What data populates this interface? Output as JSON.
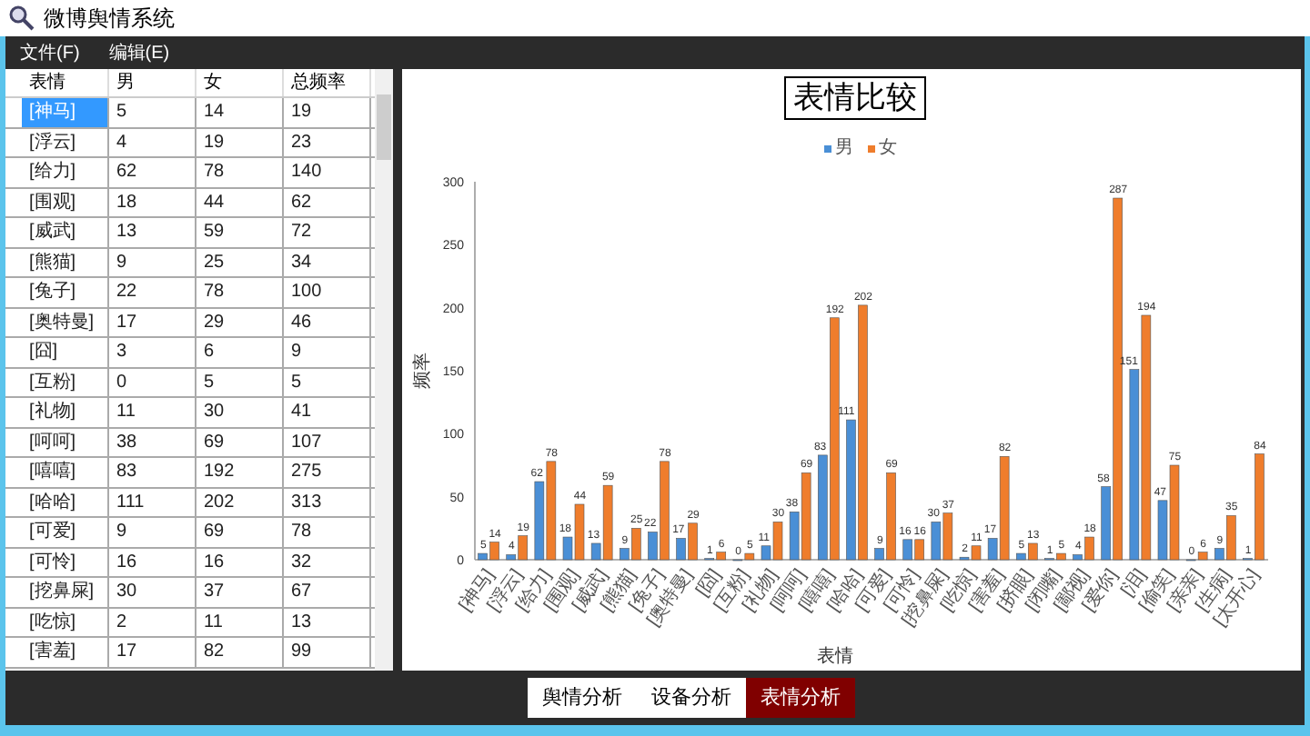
{
  "window": {
    "title": "微博舆情系统"
  },
  "menu": [
    "文件(F)",
    "编辑(E)"
  ],
  "table": {
    "columns": [
      "表情",
      "男",
      "女",
      "总频率"
    ],
    "rows": [
      {
        "cells": [
          "[神马]",
          "5",
          "14",
          "19"
        ],
        "selected": true
      },
      {
        "cells": [
          "[浮云]",
          "4",
          "19",
          "23"
        ],
        "selected": false
      },
      {
        "cells": [
          "[给力]",
          "62",
          "78",
          "140"
        ],
        "selected": false
      },
      {
        "cells": [
          "[围观]",
          "18",
          "44",
          "62"
        ],
        "selected": false
      },
      {
        "cells": [
          "[威武]",
          "13",
          "59",
          "72"
        ],
        "selected": false
      },
      {
        "cells": [
          "[熊猫]",
          "9",
          "25",
          "34"
        ],
        "selected": false
      },
      {
        "cells": [
          "[兔子]",
          "22",
          "78",
          "100"
        ],
        "selected": false
      },
      {
        "cells": [
          "[奥特曼]",
          "17",
          "29",
          "46"
        ],
        "selected": false
      },
      {
        "cells": [
          "[囧]",
          "3",
          "6",
          "9"
        ],
        "selected": false
      },
      {
        "cells": [
          "[互粉]",
          "0",
          "5",
          "5"
        ],
        "selected": false
      },
      {
        "cells": [
          "[礼物]",
          "11",
          "30",
          "41"
        ],
        "selected": false
      },
      {
        "cells": [
          "[呵呵]",
          "38",
          "69",
          "107"
        ],
        "selected": false
      },
      {
        "cells": [
          "[嘻嘻]",
          "83",
          "192",
          "275"
        ],
        "selected": false
      },
      {
        "cells": [
          "[哈哈]",
          "111",
          "202",
          "313"
        ],
        "selected": false
      },
      {
        "cells": [
          "[可爱]",
          "9",
          "69",
          "78"
        ],
        "selected": false
      },
      {
        "cells": [
          "[可怜]",
          "16",
          "16",
          "32"
        ],
        "selected": false
      },
      {
        "cells": [
          "[挖鼻屎]",
          "30",
          "37",
          "67"
        ],
        "selected": false
      },
      {
        "cells": [
          "[吃惊]",
          "2",
          "11",
          "13"
        ],
        "selected": false
      },
      {
        "cells": [
          "[害羞]",
          "17",
          "82",
          "99"
        ],
        "selected": false
      }
    ]
  },
  "chart": {
    "chart_data": {
      "type": "bar",
      "title": "表情比较",
      "xlabel": "表情",
      "ylabel": "频率",
      "categories": [
        "[神马]",
        "[浮云]",
        "[给力]",
        "[围观]",
        "[威武]",
        "[熊猫]",
        "[兔子]",
        "[奥特曼]",
        "[囧]",
        "[互粉]",
        "[礼物]",
        "[呵呵]",
        "[嘻嘻]",
        "[哈哈]",
        "[可爱]",
        "[可怜]",
        "[挖鼻屎]",
        "[吃惊]",
        "[害羞]",
        "[挤眼]",
        "[闭嘴]",
        "[鄙视]",
        "[爱你]",
        "[泪]",
        "[偷笑]",
        "[亲亲]",
        "[生病]",
        "[太开心]"
      ],
      "series": [
        {
          "name": "男",
          "color": "#4a8fd6",
          "values": [
            5,
            4,
            62,
            18,
            13,
            9,
            22,
            17,
            1,
            0,
            11,
            38,
            83,
            111,
            9,
            16,
            30,
            2,
            17,
            5,
            1,
            4,
            58,
            151,
            47,
            0,
            9,
            1
          ]
        },
        {
          "name": "女",
          "color": "#ef7d2c",
          "values": [
            14,
            19,
            78,
            44,
            59,
            25,
            78,
            29,
            6,
            5,
            30,
            69,
            192,
            202,
            69,
            16,
            37,
            11,
            82,
            13,
            5,
            18,
            287,
            194,
            75,
            6,
            35,
            84
          ]
        }
      ],
      "ylim": [
        0,
        300
      ],
      "yticks": [
        0,
        50,
        100,
        150,
        200,
        250,
        300
      ],
      "data_labels": true
    }
  },
  "tabs": [
    {
      "label": "舆情分析",
      "selected": false
    },
    {
      "label": "设备分析",
      "selected": false
    },
    {
      "label": "表情分析",
      "selected": true
    }
  ]
}
